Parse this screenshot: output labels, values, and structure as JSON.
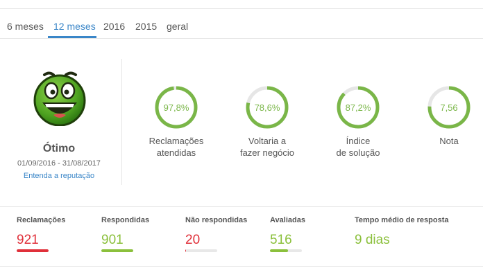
{
  "tabs": [
    {
      "label": "6 meses",
      "active": false
    },
    {
      "label": "12 meses",
      "active": true
    },
    {
      "label": "2016",
      "active": false
    },
    {
      "label": "2015",
      "active": false
    },
    {
      "label": "geral",
      "active": false
    }
  ],
  "reputation": {
    "title": "Ótimo",
    "period": "01/09/2016 - 31/08/2017",
    "link_label": "Entenda a reputação",
    "icon": "happy-face-icon"
  },
  "metrics": [
    {
      "value": "97,8%",
      "fraction": 0.978,
      "label_line1": "Reclamações",
      "label_line2": "atendidas"
    },
    {
      "value": "78,6%",
      "fraction": 0.786,
      "label_line1": "Voltaria a",
      "label_line2": "fazer negócio"
    },
    {
      "value": "87,2%",
      "fraction": 0.872,
      "label_line1": "Índice",
      "label_line2": "de solução"
    },
    {
      "value": "7,56",
      "fraction": 0.756,
      "label_line1": "Nota",
      "label_line2": ""
    }
  ],
  "stats": [
    {
      "label": "Reclamações",
      "value": "921",
      "color": "#e0303a",
      "bar_fraction": 1.0
    },
    {
      "label": "Respondidas",
      "value": "901",
      "color": "#8bc03c",
      "bar_fraction": 1.0
    },
    {
      "label": "Não respondidas",
      "value": "20",
      "color": "#e0303a",
      "bar_fraction": 0.02
    },
    {
      "label": "Avaliadas",
      "value": "516",
      "color": "#8bc03c",
      "bar_fraction": 0.56
    },
    {
      "label": "Tempo médio de resposta",
      "value": "9 dias",
      "color": "#8bc03c",
      "bar_fraction": null
    }
  ],
  "colors": {
    "accent": "#3a86c8",
    "positive": "#7ab648",
    "ring_track": "#e6e6e6",
    "negative": "#e0303a"
  }
}
